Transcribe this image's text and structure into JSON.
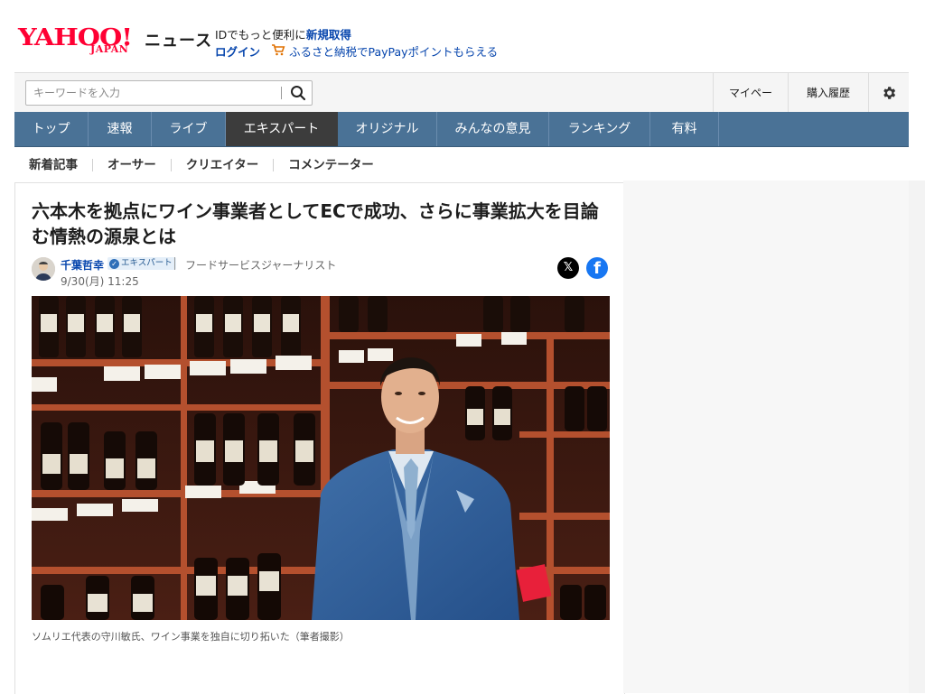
{
  "header": {
    "logo_text": "YAHOO!",
    "logo_sub": "JAPAN",
    "news_label": "ニュース",
    "promo_line1_prefix": "IDでもっと便利に",
    "promo_line1_link": "新規取得",
    "login_label": "ログイン",
    "furusato_label": "ふるさと納税でPayPayポイントもらえる"
  },
  "search": {
    "placeholder": "キーワードを入力"
  },
  "top_links": {
    "mypage": "マイページ",
    "history": "購入履歴"
  },
  "main_nav": [
    {
      "label": "トップ"
    },
    {
      "label": "速報"
    },
    {
      "label": "ライブ"
    },
    {
      "label": "エキスパート"
    },
    {
      "label": "オリジナル"
    },
    {
      "label": "みんなの意見"
    },
    {
      "label": "ランキング"
    },
    {
      "label": "有料"
    }
  ],
  "active_nav": "エキスパート",
  "sub_nav": [
    {
      "label": "新着記事"
    },
    {
      "label": "オーサー"
    },
    {
      "label": "クリエイター"
    },
    {
      "label": "コメンテーター"
    }
  ],
  "article": {
    "title": "六本木を拠点にワイン事業者としてECで成功、さらに事業拡大を目論む情熱の源泉とは",
    "author_name": "千葉哲幸",
    "expert_badge": "エキスパート",
    "author_title": "フードサービスジャーナリスト",
    "date": "9/30(月) 11:25",
    "caption": "ソムリエ代表の守川敏氏、ワイン事業を独自に切り拓いた（筆者撮影）"
  },
  "colors": {
    "logo_red": "#ff0033",
    "nav_blue": "#4a7296",
    "nav_active": "#3c3c3c",
    "link_blue": "#0645ad",
    "facebook_blue": "#1877f2"
  },
  "icons": {
    "search": "search-icon",
    "settings": "gear-icon",
    "cart": "cart-icon",
    "share_x": "x-logo-icon",
    "share_facebook": "facebook-icon"
  }
}
